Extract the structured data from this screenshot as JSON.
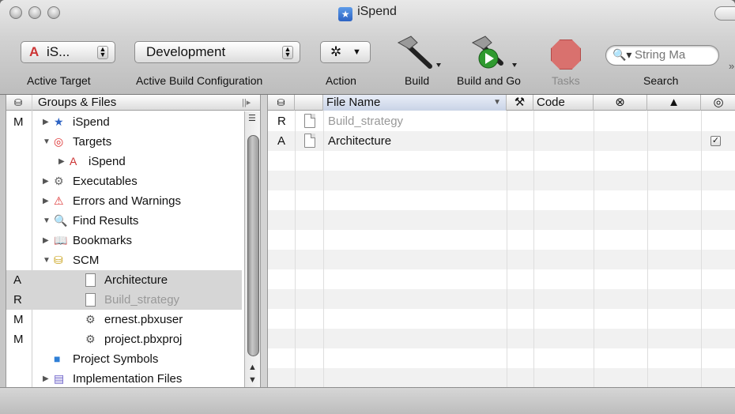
{
  "window": {
    "title": "iSpend"
  },
  "toolbar": {
    "active_target": {
      "value": "iS...",
      "label": "Active Target"
    },
    "build_config": {
      "value": "Development",
      "label": "Active Build Configuration"
    },
    "action": {
      "label": "Action"
    },
    "build": {
      "label": "Build"
    },
    "build_and_go": {
      "label": "Build and Go"
    },
    "tasks": {
      "label": "Tasks"
    },
    "search": {
      "placeholder": "String Ma",
      "label": "Search"
    }
  },
  "groups_files": {
    "header": "Groups & Files",
    "items": [
      {
        "status": "M",
        "label": "iSpend",
        "icon": "xcode-project-icon",
        "indent": 0,
        "tri": "right"
      },
      {
        "status": "",
        "label": "Targets",
        "icon": "target-icon",
        "indent": 0,
        "tri": "down"
      },
      {
        "status": "",
        "label": "iSpend",
        "icon": "app-target-icon",
        "indent": 1,
        "tri": "right"
      },
      {
        "status": "",
        "label": "Executables",
        "icon": "executables-icon",
        "indent": 0,
        "tri": "right"
      },
      {
        "status": "",
        "label": "Errors and Warnings",
        "icon": "warning-icon",
        "indent": 0,
        "tri": "right"
      },
      {
        "status": "",
        "label": "Find Results",
        "icon": "magnifier-icon",
        "indent": 0,
        "tri": "down"
      },
      {
        "status": "",
        "label": "Bookmarks",
        "icon": "bookmarks-icon",
        "indent": 0,
        "tri": "right"
      },
      {
        "status": "",
        "label": "SCM",
        "icon": "scm-icon",
        "indent": 0,
        "tri": "down"
      },
      {
        "status": "A",
        "label": "Architecture",
        "icon": "document-icon",
        "indent": 2,
        "tri": ""
      },
      {
        "status": "R",
        "label": "Build_strategy",
        "icon": "document-icon",
        "indent": 2,
        "tri": ""
      },
      {
        "status": "M",
        "label": "ernest.pbxuser",
        "icon": "pbx-file-icon",
        "indent": 2,
        "tri": ""
      },
      {
        "status": "M",
        "label": "project.pbxproj",
        "icon": "pbx-file-icon",
        "indent": 2,
        "tri": ""
      },
      {
        "status": "",
        "label": "Project Symbols",
        "icon": "symbols-icon",
        "indent": 0,
        "tri": ""
      },
      {
        "status": "",
        "label": "Implementation Files",
        "icon": "implementation-icon",
        "indent": 0,
        "tri": "right"
      }
    ]
  },
  "file_list": {
    "columns": {
      "file_name": "File Name",
      "code": "Code"
    },
    "rows": [
      {
        "status": "R",
        "name": "Build_strategy",
        "checked": false
      },
      {
        "status": "A",
        "name": "Architecture",
        "checked": true
      }
    ]
  },
  "colors": {
    "accent": "#2d63c3",
    "stop": "#d9716e"
  }
}
